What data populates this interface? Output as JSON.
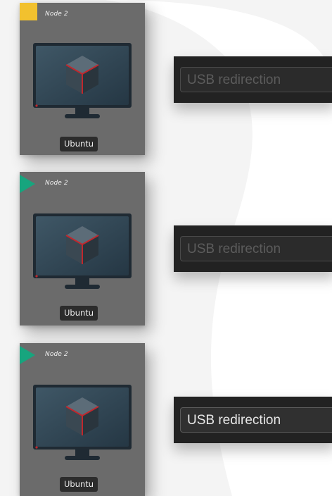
{
  "nodes": [
    {
      "name": "Node 2",
      "os": "Ubuntu",
      "status": "square",
      "status_color": "#f2c12e",
      "usb_label": "USB redirection",
      "usb_enabled": false
    },
    {
      "name": "Node 2",
      "os": "Ubuntu",
      "status": "play",
      "status_color": "#17a57e",
      "usb_label": "USB redirection",
      "usb_enabled": false
    },
    {
      "name": "Node 2",
      "os": "Ubuntu",
      "status": "play",
      "status_color": "#17a57e",
      "usb_label": "USB redirection",
      "usb_enabled": true
    }
  ],
  "colors": {
    "card_bg": "#6b6b6b",
    "panel_bg": "#222222",
    "accent_red": "#c1272d"
  }
}
